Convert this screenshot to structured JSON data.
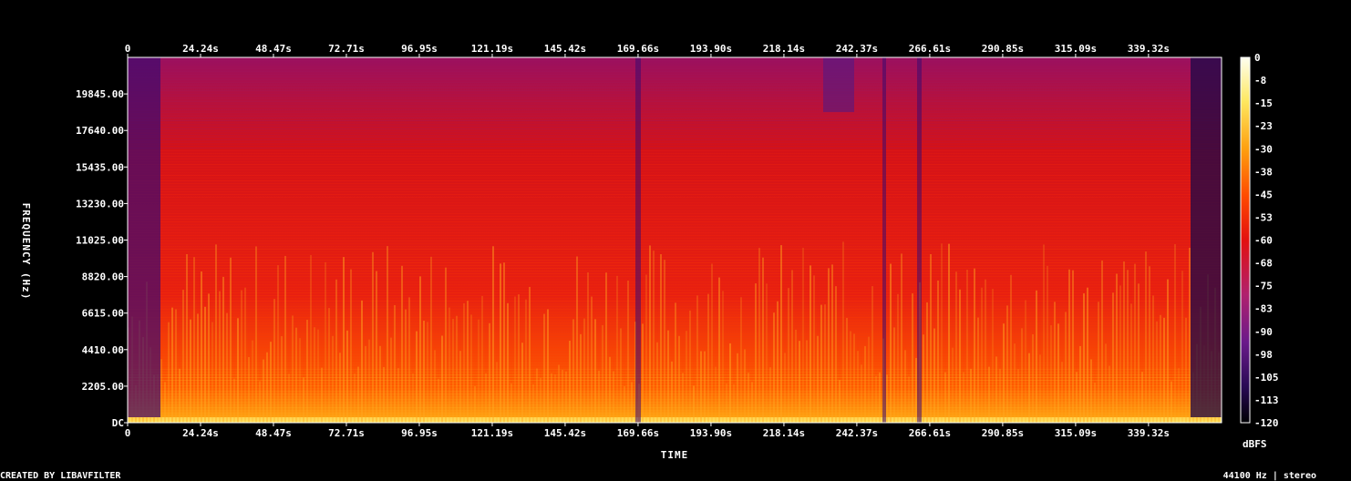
{
  "chart_data": {
    "type": "heatmap",
    "title": "",
    "xlabel": "TIME",
    "ylabel": "FREQUENCY (Hz)",
    "colorbar_label": "dBFS",
    "x_ticks": [
      "0",
      "24.24s",
      "48.47s",
      "72.71s",
      "96.95s",
      "121.19s",
      "145.42s",
      "169.66s",
      "193.90s",
      "218.14s",
      "242.37s",
      "266.61s",
      "290.85s",
      "315.09s",
      "339.32s"
    ],
    "x_tick_values": [
      0,
      24.24,
      48.47,
      72.71,
      96.95,
      121.19,
      145.42,
      169.66,
      193.9,
      218.14,
      242.37,
      266.61,
      290.85,
      315.09,
      339.32
    ],
    "xlim": [
      0,
      363.6
    ],
    "y_ticks": [
      "DC",
      "2205.00",
      "4410.00",
      "6615.00",
      "8820.00",
      "11025.00",
      "13230.00",
      "15435.00",
      "17640.00",
      "19845.00"
    ],
    "y_tick_values": [
      0,
      2205,
      4410,
      6615,
      8820,
      11025,
      13230,
      15435,
      17640,
      19845
    ],
    "ylim": [
      0,
      22050
    ],
    "colorbar_ticks": [
      "0",
      "-8",
      "-15",
      "-23",
      "-30",
      "-38",
      "-45",
      "-53",
      "-60",
      "-68",
      "-75",
      "-83",
      "-90",
      "-98",
      "-105",
      "-113",
      "-120"
    ],
    "colorbar_range": [
      -120,
      0
    ],
    "grid": false,
    "colors": [
      "#000004",
      "#2a0a55",
      "#6a1a8a",
      "#b0206e",
      "#e3100f",
      "#ff4a00",
      "#ffa010",
      "#ffe860",
      "#fffff0"
    ]
  },
  "footer": {
    "left": "CREATED BY LIBAVFILTER",
    "right": "44100 Hz | stereo"
  }
}
